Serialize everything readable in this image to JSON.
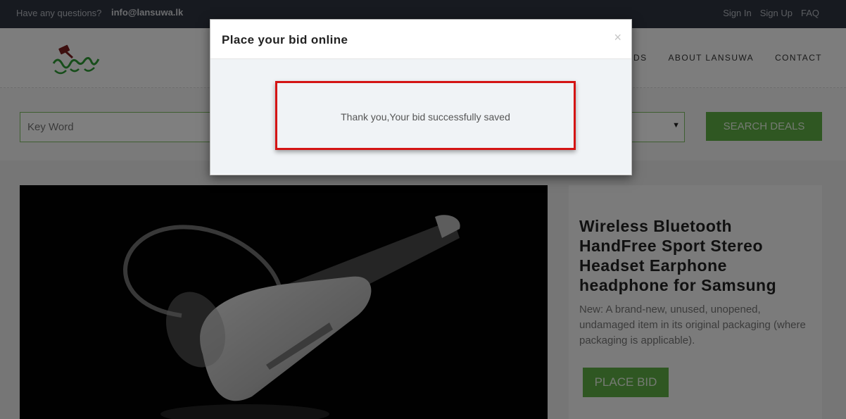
{
  "topbar": {
    "question": "Have any questions?",
    "email": "info@lansuwa.lk",
    "links": [
      "Sign In",
      "Sign Up",
      "FAQ"
    ]
  },
  "nav": {
    "items": [
      "DS",
      "ABOUT LANSUWA",
      "CONTACT"
    ]
  },
  "search": {
    "keyword_placeholder": "Key Word",
    "button_label": "SEARCH DEALS"
  },
  "product": {
    "title": "Wireless Bluetooth HandFree Sport Stereo Headset Earphone headphone for Samsung",
    "description": "New: A brand-new, unused, unopened, undamaged item in its original packaging (where packaging is applicable).",
    "bid_button": "PLACE BID"
  },
  "modal": {
    "title": "Place your bid online",
    "close": "×",
    "message": "Thank you,Your bid successfully saved"
  },
  "colors": {
    "accent_green": "#5fae45",
    "topbar": "#2e3440",
    "highlight_red": "#d41414"
  }
}
